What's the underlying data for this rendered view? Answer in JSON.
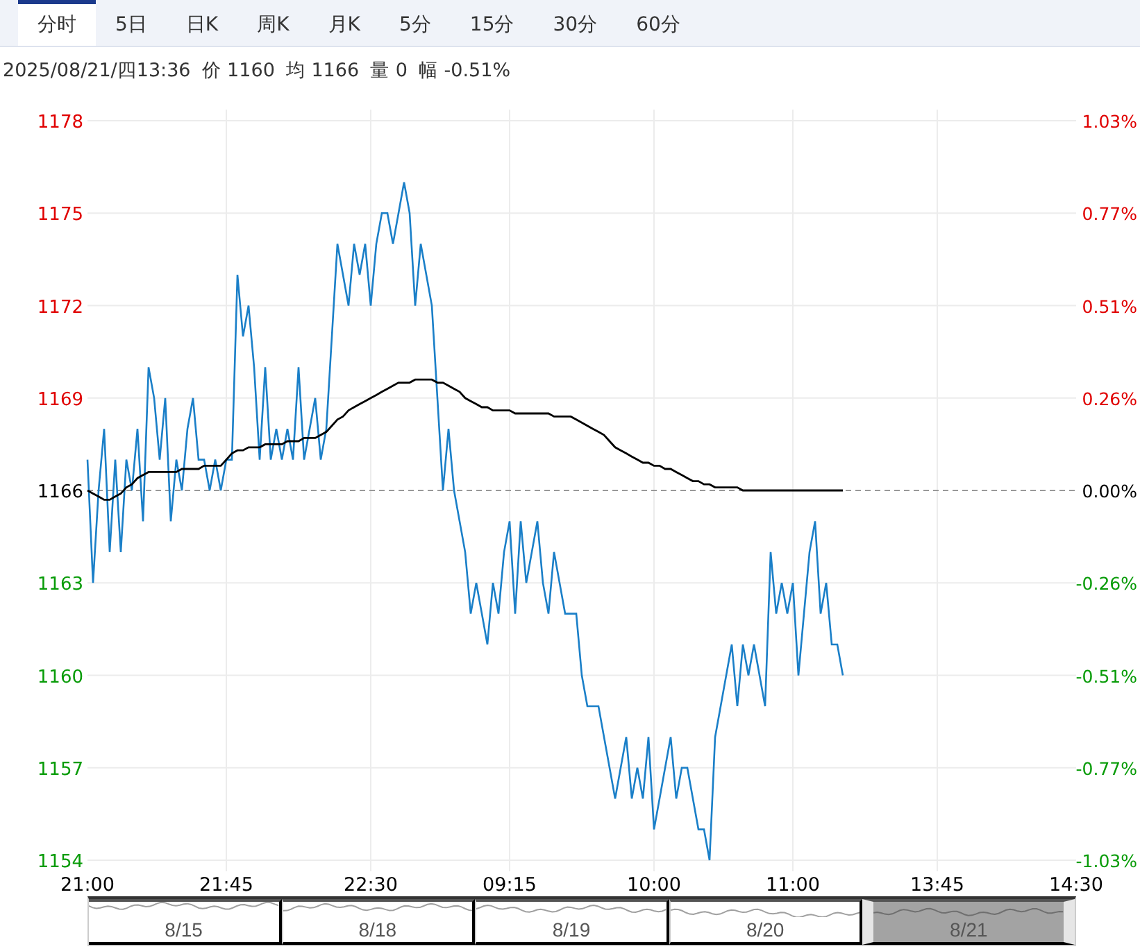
{
  "tabs": [
    {
      "label": "分时",
      "selected": true
    },
    {
      "label": "5日",
      "selected": false
    },
    {
      "label": "日K",
      "selected": false
    },
    {
      "label": "周K",
      "selected": false
    },
    {
      "label": "月K",
      "selected": false
    },
    {
      "label": "5分",
      "selected": false
    },
    {
      "label": "15分",
      "selected": false
    },
    {
      "label": "30分",
      "selected": false
    },
    {
      "label": "60分",
      "selected": false
    }
  ],
  "quote": {
    "datetime": "2025/08/21/四13:36",
    "fields": [
      {
        "label": "价",
        "value": "1160"
      },
      {
        "label": "均",
        "value": "1166"
      },
      {
        "label": "量",
        "value": "0"
      },
      {
        "label": "幅",
        "value": "-0.51%"
      }
    ]
  },
  "chart": {
    "chart_data": {
      "type": "line",
      "grid": true,
      "ylim": [
        1154,
        1178
      ],
      "categories": [
        "21:00",
        null,
        null,
        null,
        null,
        null,
        null,
        null,
        null,
        null,
        null,
        null,
        null,
        null,
        null,
        null,
        null,
        null,
        null,
        null,
        null,
        null,
        null,
        null,
        null,
        "21:45",
        null,
        null,
        null,
        null,
        null,
        null,
        null,
        null,
        null,
        null,
        null,
        null,
        null,
        null,
        null,
        null,
        null,
        null,
        null,
        null,
        null,
        null,
        null,
        null,
        null,
        "22:30",
        null,
        null,
        null,
        null,
        null,
        null,
        null,
        null,
        null,
        null,
        null,
        null,
        null,
        null,
        null,
        null,
        null,
        null,
        null,
        null,
        null,
        null,
        null,
        null,
        "09:15",
        null,
        null,
        null,
        null,
        null,
        null,
        null,
        null,
        null,
        null,
        null,
        null,
        null,
        null,
        null,
        null,
        null,
        null,
        null,
        null,
        null,
        null,
        null,
        null,
        null,
        "10:00",
        null,
        null,
        null,
        null,
        null,
        null,
        null,
        null,
        null,
        null,
        null,
        null,
        null,
        null,
        null,
        null,
        null,
        null,
        null,
        null,
        null,
        null,
        null,
        null,
        "11:00",
        null,
        null,
        null,
        null,
        null,
        null,
        null,
        null,
        null,
        null,
        null,
        null,
        null,
        null,
        null,
        null,
        null,
        null,
        null,
        null,
        null,
        null,
        null,
        null,
        null,
        "13:45",
        null,
        null,
        null,
        null,
        null,
        null,
        null,
        null,
        null,
        null,
        null,
        null,
        null,
        null,
        null,
        null,
        null,
        null,
        null,
        null,
        null,
        null,
        null,
        null,
        "14:30"
      ],
      "yticks": [
        1178,
        1175,
        1172,
        1169,
        1166,
        1163,
        1160,
        1157,
        1154
      ],
      "ref_lines": [
        {
          "axis": "y",
          "value": 1166
        }
      ],
      "series": [
        {
          "color": "#1a7fc8",
          "values": [
            1167,
            1163,
            1166,
            1168,
            1164,
            1167,
            1164,
            1167,
            1166,
            1168,
            1165,
            1170,
            1169,
            1167,
            1169,
            1165,
            1167,
            1166,
            1168,
            1169,
            1167,
            1167,
            1166,
            1167,
            1166,
            1167,
            1167,
            1173,
            1171,
            1172,
            1170,
            1167,
            1170,
            1167,
            1168,
            1167,
            1168,
            1167,
            1170,
            1167,
            1168,
            1169,
            1167,
            1168,
            1171,
            1174,
            1173,
            1172,
            1174,
            1173,
            1174,
            1172,
            1174,
            1175,
            1175,
            1174,
            1175,
            1176,
            1175,
            1172,
            1174,
            1173,
            1172,
            1169,
            1166,
            1168,
            1166,
            1165,
            1164,
            1162,
            1163,
            1162,
            1161,
            1163,
            1162,
            1164,
            1165,
            1162,
            1165,
            1163,
            1164,
            1165,
            1163,
            1162,
            1164,
            1163,
            1162,
            1162,
            1162,
            1160,
            1159,
            1159,
            1159,
            1158,
            1157,
            1156,
            1157,
            1158,
            1156,
            1157,
            1156,
            1158,
            1155,
            1156,
            1157,
            1158,
            1156,
            1157,
            1157,
            1156,
            1155,
            1155,
            1154,
            1158,
            1159,
            1160,
            1161,
            1159,
            1161,
            1160,
            1161,
            1160,
            1159,
            1164,
            1162,
            1163,
            1162,
            1163,
            1160,
            1162,
            1164,
            1165,
            1162,
            1163,
            1161,
            1161,
            1160,
            null,
            null,
            null,
            null,
            null,
            null,
            null,
            null,
            null,
            null,
            null,
            null,
            null,
            null,
            null,
            null,
            null,
            null,
            null,
            null,
            null,
            null,
            null,
            null,
            null,
            null,
            null,
            null,
            null,
            null,
            null,
            null,
            null,
            null,
            null,
            null,
            null,
            null,
            null,
            null,
            null,
            null
          ]
        },
        {
          "color": "#000000",
          "values": [
            1166,
            1165.9,
            1165.8,
            1165.7,
            1165.7,
            1165.8,
            1165.9,
            1166.1,
            1166.2,
            1166.4,
            1166.5,
            1166.6,
            1166.6,
            1166.6,
            1166.6,
            1166.6,
            1166.6,
            1166.7,
            1166.7,
            1166.7,
            1166.7,
            1166.8,
            1166.8,
            1166.8,
            1166.8,
            1167,
            1167.2,
            1167.3,
            1167.3,
            1167.4,
            1167.4,
            1167.4,
            1167.5,
            1167.5,
            1167.5,
            1167.5,
            1167.6,
            1167.6,
            1167.6,
            1167.7,
            1167.7,
            1167.7,
            1167.8,
            1167.9,
            1168.1,
            1168.3,
            1168.4,
            1168.6,
            1168.7,
            1168.8,
            1168.9,
            1169,
            1169.1,
            1169.2,
            1169.3,
            1169.4,
            1169.5,
            1169.5,
            1169.5,
            1169.6,
            1169.6,
            1169.6,
            1169.6,
            1169.5,
            1169.5,
            1169.4,
            1169.3,
            1169.2,
            1169,
            1168.9,
            1168.8,
            1168.7,
            1168.7,
            1168.6,
            1168.6,
            1168.6,
            1168.6,
            1168.5,
            1168.5,
            1168.5,
            1168.5,
            1168.5,
            1168.5,
            1168.5,
            1168.4,
            1168.4,
            1168.4,
            1168.4,
            1168.3,
            1168.2,
            1168.1,
            1168,
            1167.9,
            1167.8,
            1167.6,
            1167.4,
            1167.3,
            1167.2,
            1167.1,
            1167,
            1166.9,
            1166.9,
            1166.8,
            1166.8,
            1166.7,
            1166.7,
            1166.6,
            1166.5,
            1166.4,
            1166.3,
            1166.3,
            1166.2,
            1166.2,
            1166.1,
            1166.1,
            1166.1,
            1166.1,
            1166.1,
            1166,
            1166,
            1166,
            1166,
            1166,
            1166,
            1166,
            1166,
            1166,
            1166,
            1166,
            1166,
            1166,
            1166,
            1166,
            1166,
            1166,
            1166,
            1166,
            null,
            null,
            null,
            null,
            null,
            null,
            null,
            null,
            null,
            null,
            null,
            null,
            null,
            null,
            null,
            null,
            null,
            null,
            null,
            null,
            null,
            null,
            null,
            null,
            null,
            null,
            null,
            null,
            null,
            null,
            null,
            null,
            null,
            null,
            null,
            null,
            null,
            null,
            null,
            null,
            null,
            null
          ]
        }
      ]
    },
    "percent_labels": [
      "1.03%",
      "0.77%",
      "0.51%",
      "0.26%",
      "0.00%",
      "-0.26%",
      "-0.51%",
      "-0.77%",
      "-1.03%"
    ]
  },
  "navigator": {
    "days": [
      {
        "label": "8/15",
        "selected": false
      },
      {
        "label": "8/18",
        "selected": false
      },
      {
        "label": "8/19",
        "selected": false
      },
      {
        "label": "8/20",
        "selected": false
      },
      {
        "label": "8/21",
        "selected": true
      }
    ]
  }
}
